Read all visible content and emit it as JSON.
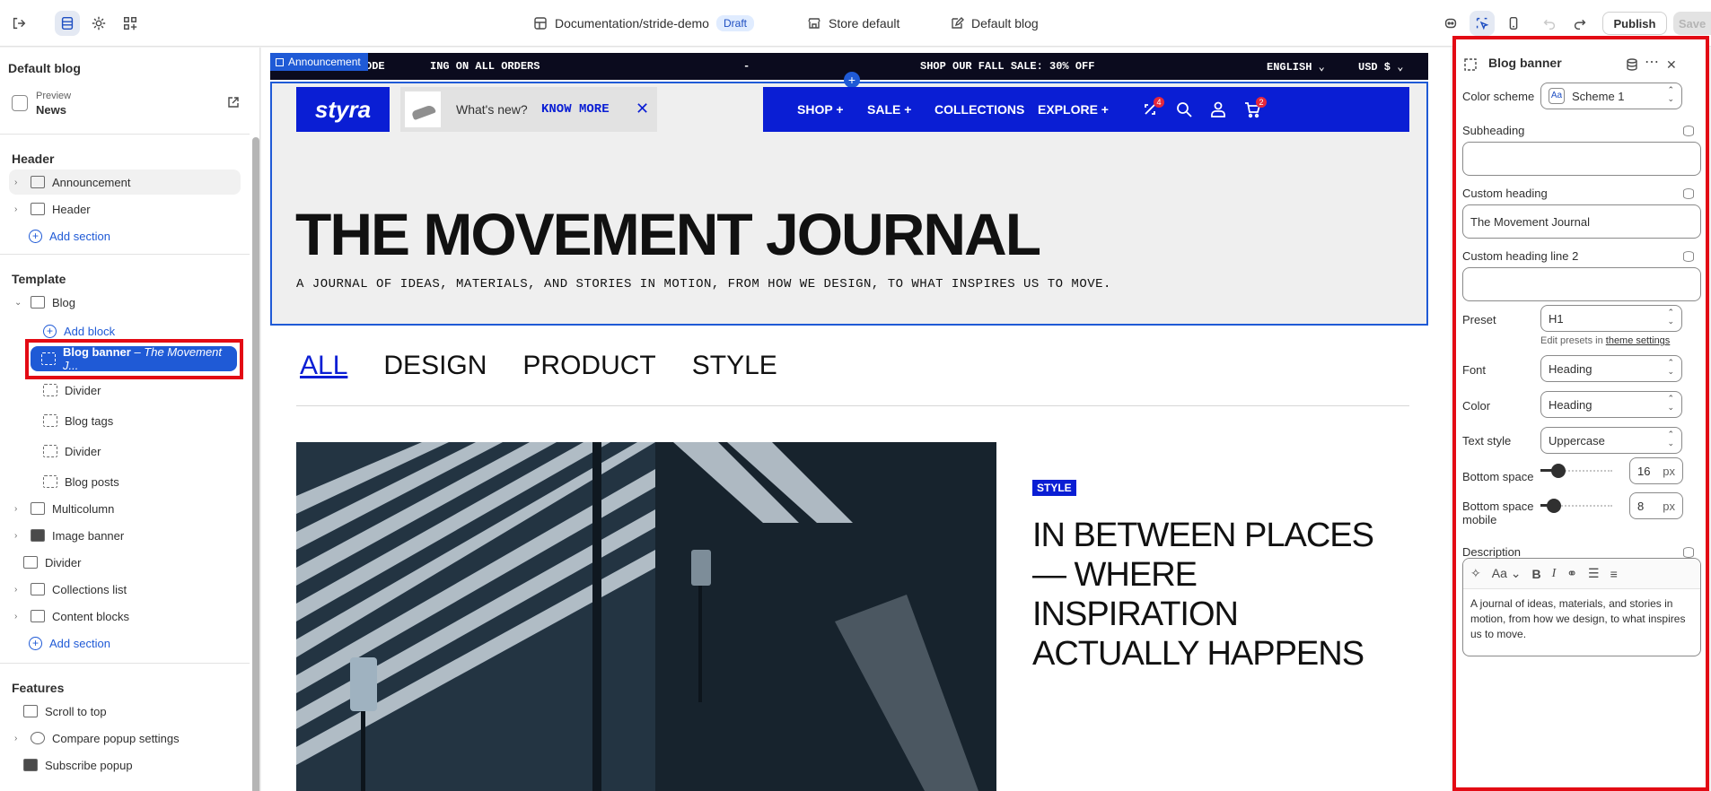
{
  "topbar": {
    "store_path": "Documentation/stride-demo",
    "status": "Draft",
    "theme": "Store default",
    "template": "Default blog",
    "publish_label": "Publish",
    "save_label": "Save"
  },
  "sidebar": {
    "title": "Default blog",
    "preview_label": "Preview",
    "preview_page": "News",
    "header_group": "Header",
    "header_items": [
      "Announcement",
      "Header"
    ],
    "add_section": "Add section",
    "template_group": "Template",
    "blog_label": "Blog",
    "add_block": "Add block",
    "selected_item": "Blog banner",
    "selected_suffix": "– The Movement J...",
    "blog_blocks": [
      "Divider",
      "Blog tags",
      "Divider",
      "Blog posts"
    ],
    "template_items": [
      "Multicolumn",
      "Image banner",
      "Divider",
      "Collections list",
      "Content blocks"
    ],
    "features_group": "Features",
    "features_items": [
      "Scroll to top",
      "Compare popup settings",
      "Subscribe popup"
    ]
  },
  "canvas": {
    "announcement_tag": "Announcement",
    "announcement_texts": [
      "ODE",
      "ING ON ALL ORDERS",
      "-",
      "SHOP OUR FALL SALE: 30% OFF"
    ],
    "language": "ENGLISH",
    "currency": "USD $",
    "logo": "styra",
    "whats_new": "What's new?",
    "know_more": "KNOW MORE",
    "nav": [
      "SHOP +",
      "SALE +",
      "COLLECTIONS",
      "EXPLORE +"
    ],
    "compare_count": "4",
    "cart_count": "2",
    "hero_title": "THE MOVEMENT JOURNAL",
    "hero_subtitle": "A JOURNAL OF IDEAS, MATERIALS, AND STORIES IN MOTION, FROM HOW WE DESIGN, TO WHAT INSPIRES US TO MOVE.",
    "tabs": [
      "ALL",
      "DESIGN",
      "PRODUCT",
      "STYLE"
    ],
    "card_tag": "STYLE",
    "card_title": "IN BETWEEN PLACES — WHERE INSPIRATION ACTUALLY HAPPENS"
  },
  "panel": {
    "title": "Blog banner",
    "color_scheme_label": "Color scheme",
    "color_scheme_value": "Scheme 1",
    "color_scheme_swatch": "Aa",
    "subheading_label": "Subheading",
    "subheading_value": "",
    "custom_heading_label": "Custom heading",
    "custom_heading_value": "The Movement Journal",
    "custom_heading2_label": "Custom heading line 2",
    "custom_heading2_value": "",
    "preset_label": "Preset",
    "preset_value": "H1",
    "preset_help": "Edit presets in",
    "preset_help_link": "theme settings",
    "font_label": "Font",
    "font_value": "Heading",
    "color_label": "Color",
    "color_value": "Heading",
    "text_style_label": "Text style",
    "text_style_value": "Uppercase",
    "bottom_space_label": "Bottom space",
    "bottom_space_value": "16",
    "bottom_space_mobile_label": "Bottom space mobile",
    "bottom_space_mobile_value": "8",
    "unit": "px",
    "description_label": "Description",
    "description_value": "A journal of ideas, materials, and stories in motion, from how we design, to what inspires us to move."
  },
  "colors": {
    "accent": "#1f5ad6",
    "brand": "#0a1ed4",
    "highlight": "#e30a14"
  }
}
